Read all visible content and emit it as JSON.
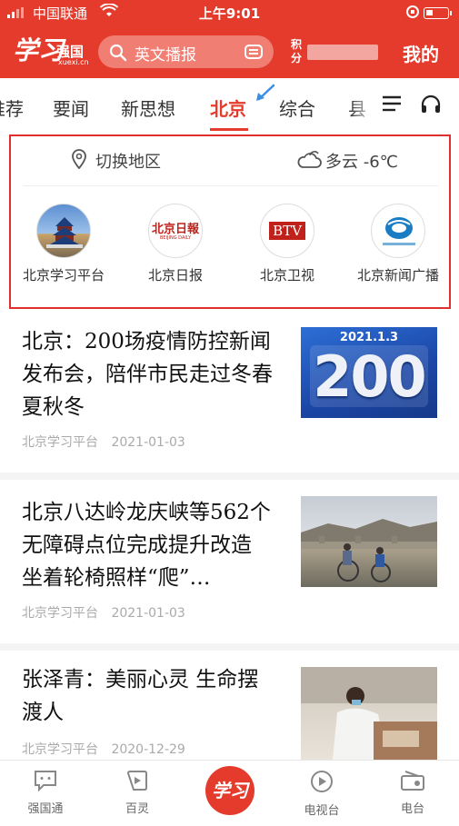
{
  "status_bar": {
    "carrier": "中国联通",
    "time": "上午9:01"
  },
  "header": {
    "logo_text": "学习",
    "logo_sub": "强国",
    "logo_url": "xuexi.cn",
    "search_placeholder": "英文播报",
    "points_label": "积分",
    "mine_label": "我的"
  },
  "tabs": [
    {
      "label": "推荐",
      "active": false
    },
    {
      "label": "要闻",
      "active": false
    },
    {
      "label": "新思想",
      "active": false
    },
    {
      "label": "北京",
      "active": true
    },
    {
      "label": "综合",
      "active": false
    },
    {
      "label": "县",
      "active": false
    }
  ],
  "region_panel": {
    "switch_label": "切换地区",
    "weather": "多云 -6℃",
    "channels": [
      {
        "name": "北京学习平台",
        "icon": "temple-of-heaven-icon"
      },
      {
        "name": "北京日报",
        "icon": "beijing-daily-logo",
        "logo_text": "北京日報",
        "logo_sub": "BEIJING DAILY"
      },
      {
        "name": "北京卫视",
        "icon": "btv-logo",
        "logo_text": "BTV"
      },
      {
        "name": "北京新闻广播",
        "icon": "beijing-news-radio-logo"
      }
    ]
  },
  "news": [
    {
      "title": "北京：200场疫情防控新闻发布会，陪伴市民走过冬春夏秋冬",
      "source": "北京学习平台",
      "date": "2021-01-03",
      "thumb_date": "2021.1.3",
      "thumb_number": "200"
    },
    {
      "title": "北京八达岭龙庆峡等562个无障碍点位完成提升改造 坐着轮椅照样“爬”…",
      "source": "北京学习平台",
      "date": "2021-01-03"
    },
    {
      "title": "张泽青：美丽心灵 生命摆渡人",
      "source": "北京学习平台",
      "date": "2020-12-29"
    }
  ],
  "bottom_nav": [
    {
      "label": "强国通",
      "icon": "chat-icon"
    },
    {
      "label": "百灵",
      "icon": "play-square-icon"
    },
    {
      "label": "",
      "icon": "xuexi-logo",
      "center_text": "学习"
    },
    {
      "label": "电视台",
      "icon": "play-circle-icon"
    },
    {
      "label": "电台",
      "icon": "radio-icon"
    }
  ],
  "colors": {
    "brand_red": "#e43b2c",
    "highlight_border": "#e02f2f",
    "arrow_blue": "#3a8ee6"
  }
}
